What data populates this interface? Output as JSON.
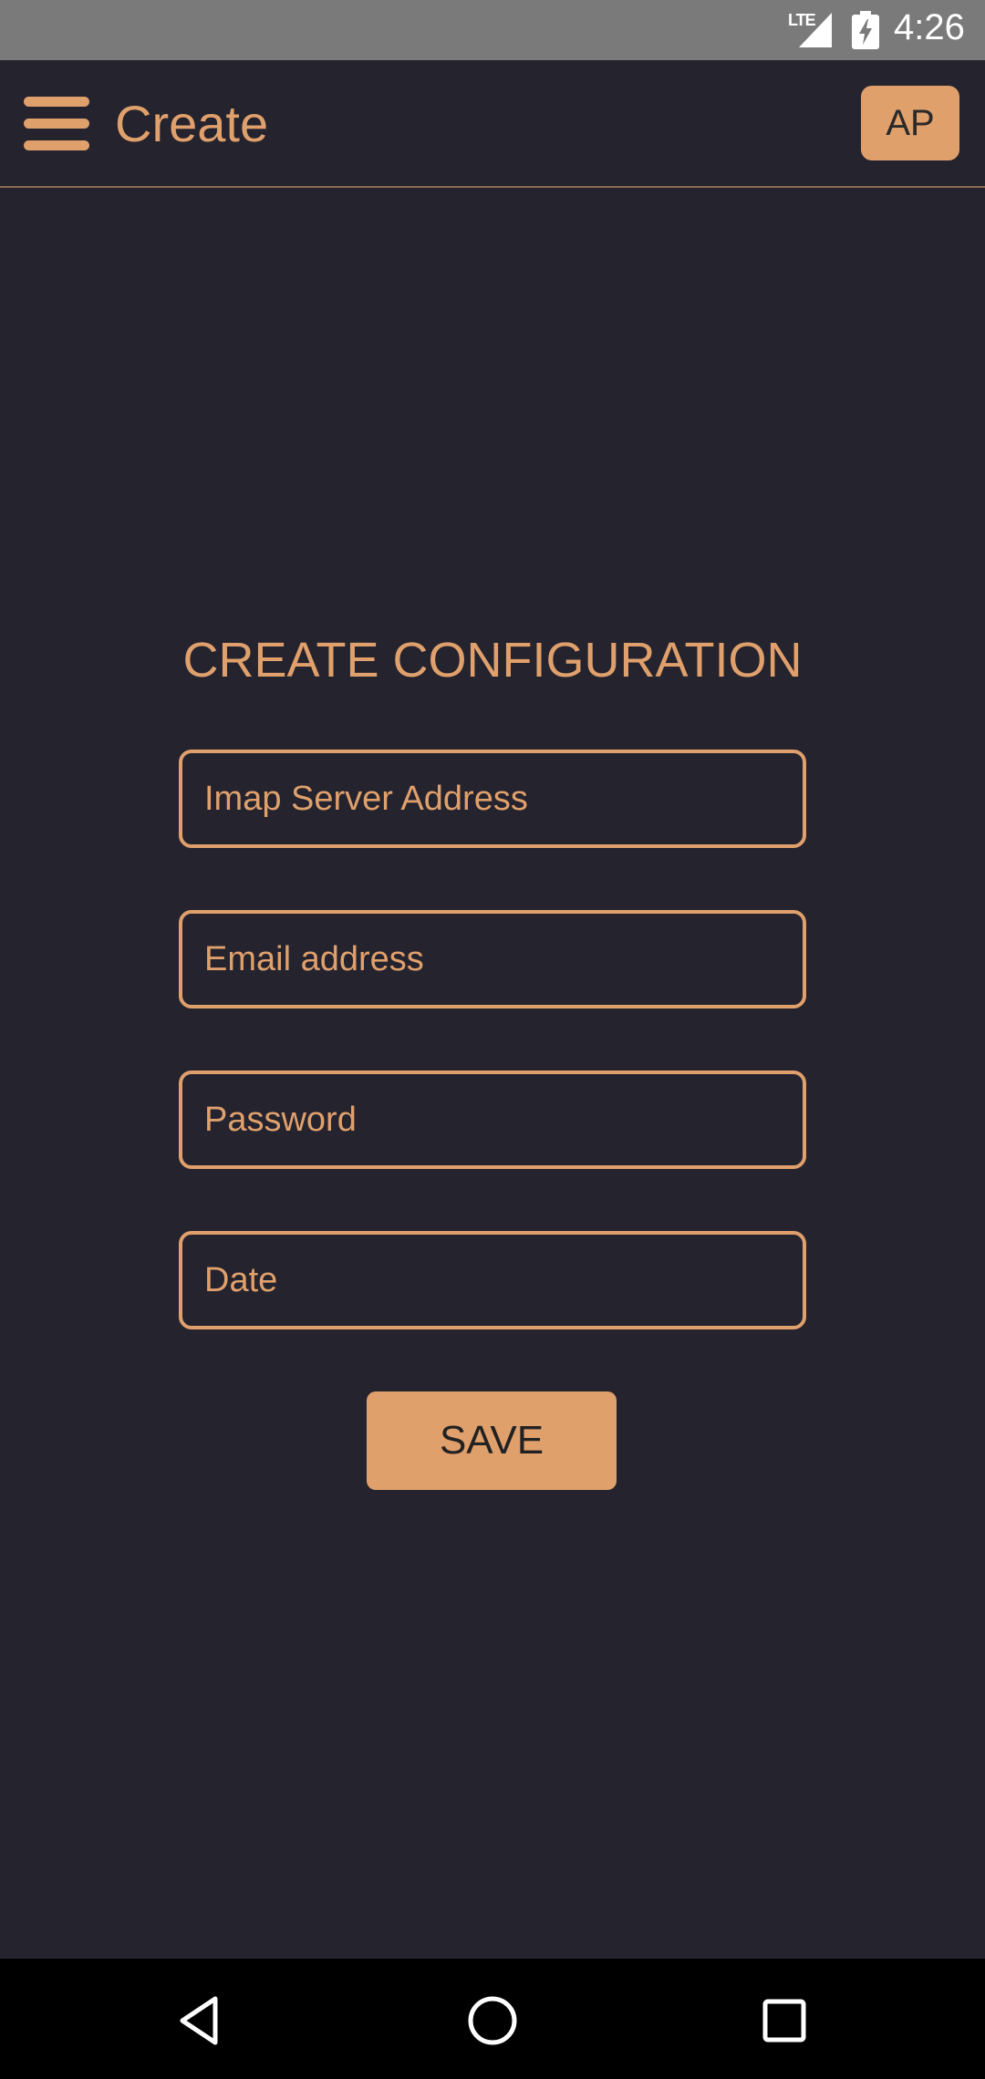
{
  "status_bar": {
    "network": "LTE",
    "time": "4:26"
  },
  "app_bar": {
    "title": "Create",
    "avatar_initials": "AP",
    "icons": [
      "menu-icon"
    ]
  },
  "form": {
    "heading": "CREATE CONFIGURATION",
    "fields": [
      {
        "placeholder": "Imap Server Address",
        "value": ""
      },
      {
        "placeholder": "Email address",
        "value": ""
      },
      {
        "placeholder": "Password",
        "value": ""
      },
      {
        "placeholder": "Date",
        "value": ""
      }
    ],
    "save_label": "SAVE"
  },
  "nav_bar": {
    "icons": [
      "back-icon",
      "home-icon",
      "recents-icon"
    ]
  },
  "colors": {
    "accent": "#e0a06c",
    "background": "#24232e",
    "status_bar": "#7a7a7a",
    "nav_bar": "#000000"
  }
}
